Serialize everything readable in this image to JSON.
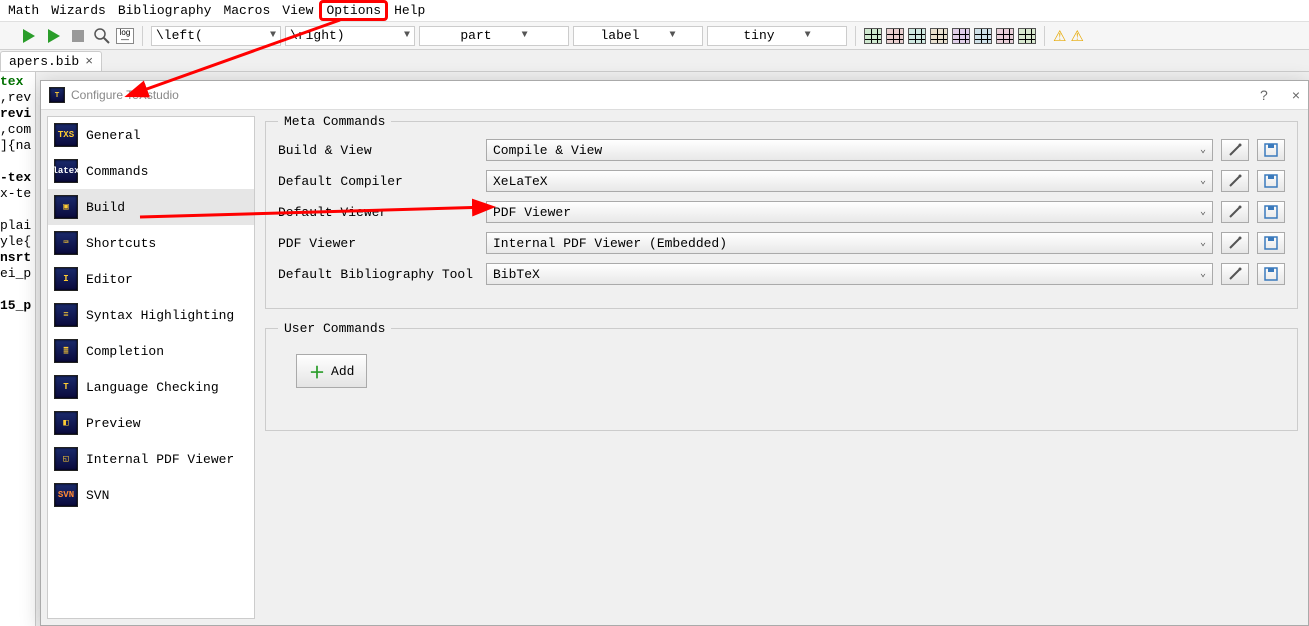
{
  "menu": {
    "items": [
      "Math",
      "Wizards",
      "Bibliography",
      "Macros",
      "View",
      "Options",
      "Help"
    ],
    "highlighted": "Options"
  },
  "toolbar": {
    "combo1": "\\left(",
    "combo2": "\\right)",
    "combo3": "part",
    "combo4": "label",
    "combo5": "tiny"
  },
  "file_tab": {
    "name": "apers.bib",
    "left_label": "tex"
  },
  "editor_snippet": {
    "l1": ",rev",
    "l2": "revi",
    "l3": ",com",
    "l4": "]{na",
    "l5": "",
    "l6": "-tex",
    "l7": "x-te",
    "l8": "",
    "l9": "plai",
    "l10": "yle{",
    "l11": "nsrt",
    "l12": "ei_p",
    "l13": "",
    "l14": "15_p"
  },
  "dialog": {
    "title": "Configure TeXstudio",
    "help": "?",
    "close": "×"
  },
  "sidebar": {
    "items": [
      {
        "label": "General",
        "icon": "TXS"
      },
      {
        "label": "Commands",
        "icon": "latex"
      },
      {
        "label": "Build",
        "icon": "▣"
      },
      {
        "label": "Shortcuts",
        "icon": "⌨"
      },
      {
        "label": "Editor",
        "icon": "I"
      },
      {
        "label": "Syntax Highlighting",
        "icon": "≡"
      },
      {
        "label": "Completion",
        "icon": "≣"
      },
      {
        "label": "Language Checking",
        "icon": "T"
      },
      {
        "label": "Preview",
        "icon": "◧"
      },
      {
        "label": "Internal PDF Viewer",
        "icon": "◱"
      },
      {
        "label": "SVN",
        "icon": "SVN"
      }
    ],
    "selected_index": 2
  },
  "meta_commands": {
    "legend": "Meta Commands",
    "rows": [
      {
        "label": "Build & View",
        "value": "Compile & View"
      },
      {
        "label": "Default Compiler",
        "value": "XeLaTeX"
      },
      {
        "label": "Default Viewer",
        "value": "PDF Viewer"
      },
      {
        "label": "PDF Viewer",
        "value": "Internal PDF Viewer (Embedded)"
      },
      {
        "label": "Default Bibliography Tool",
        "value": "BibTeX"
      }
    ]
  },
  "user_commands": {
    "legend": "User Commands",
    "add_label": "Add"
  }
}
